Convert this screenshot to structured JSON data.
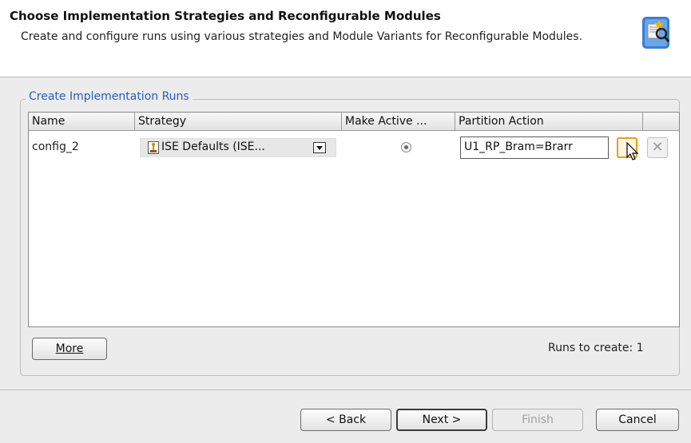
{
  "header": {
    "title": "Choose Implementation Strategies and Reconfigurable Modules",
    "description": "Create and configure runs using various strategies and Module Variants for Reconfigurable Modules."
  },
  "group": {
    "title": "Create Implementation Runs"
  },
  "table": {
    "columns": [
      "Name",
      "Strategy",
      "Make Active ...",
      "Partition Action"
    ],
    "rows": [
      {
        "name": "config_2",
        "strategy": "ISE Defaults (ISE...",
        "make_active": true,
        "partition_action": "U1_RP_Bram=Brarr"
      }
    ]
  },
  "more_button": {
    "label": "More"
  },
  "runs_to_create": "Runs to create: 1",
  "footer": {
    "back": "< Back",
    "next": "Next >",
    "finish": "Finish",
    "cancel": "Cancel"
  },
  "icons": {
    "header": "wizard-icon",
    "strategy": "strategy-icon",
    "edit": "edit-partition-icon",
    "remove": "close-icon",
    "combo": "chevron-down-icon"
  },
  "colors": {
    "group_title": "#2a5db8",
    "edit_highlight": "#e0a020",
    "header_bg": "#ffffff",
    "dialog_bg": "#ececec"
  }
}
